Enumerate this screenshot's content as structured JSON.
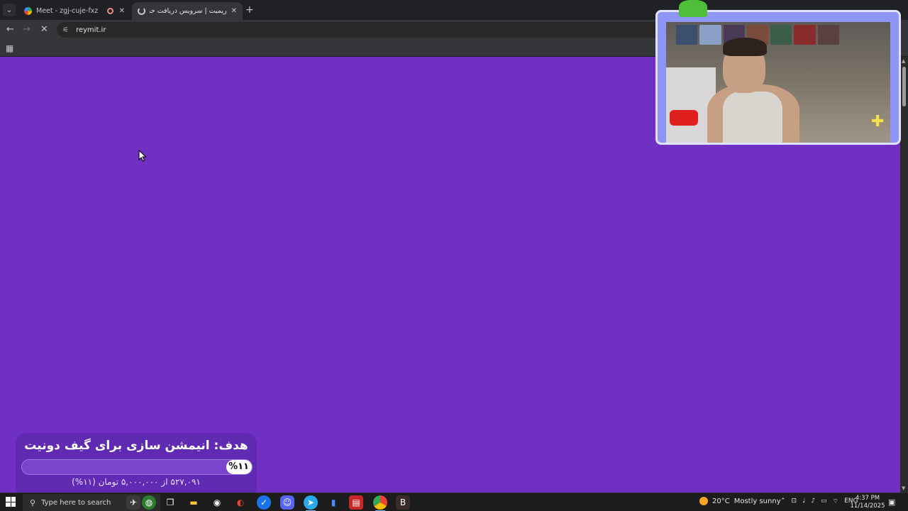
{
  "browser": {
    "tabs": [
      {
        "title": "Meet - zgj-cuje-fxz",
        "active": false
      },
      {
        "title": "ریمیت | سرویس دریافت حمایت ..",
        "active": true
      }
    ],
    "new_tab": "+",
    "address": "reymit.ir"
  },
  "page": {
    "background": "#7130c4"
  },
  "goal_widget": {
    "title": "هدف: انیمشن سازی برای گیف دونیت",
    "percent_label": "%۱۱",
    "progress": 0.11,
    "subtitle": "۵۲۷,۰۹۱ از ۵,۰۰۰,۰۰۰ تومان (۱۱%)"
  },
  "taskbar": {
    "search_placeholder": "Type here to search",
    "weather": {
      "temp": "20°C",
      "condition": "Mostly sunny"
    },
    "tray_lang": "ENG",
    "time": "4:37 PM",
    "date": "11/14/2025"
  }
}
